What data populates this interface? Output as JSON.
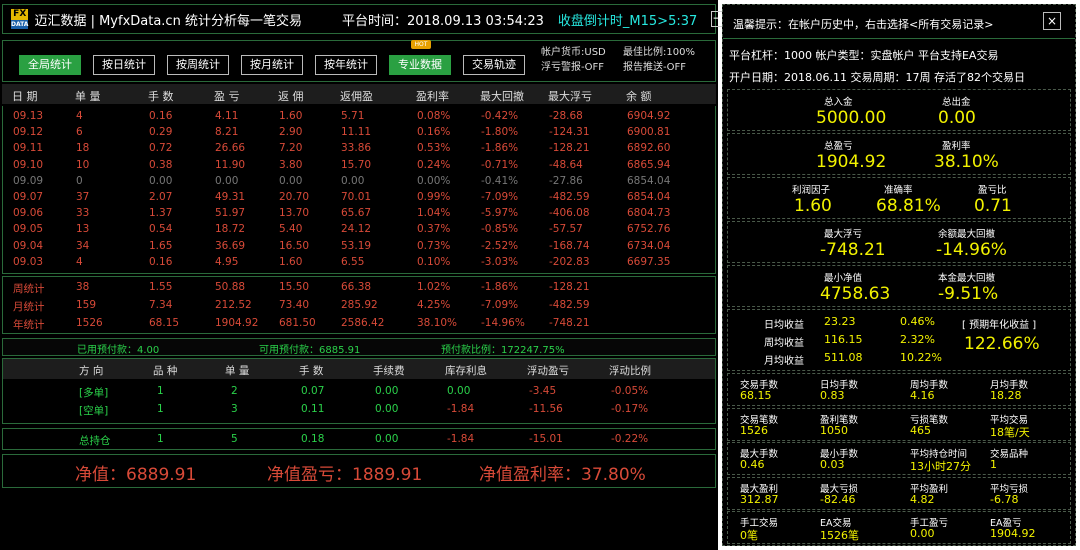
{
  "header": {
    "logo_top": "FX",
    "logo_bottom": "DATA",
    "title": "迈汇数据 | MyfxData.cn  统计分析每一笔交易",
    "platform_time": "平台时间：2018.09.13 03:54:23",
    "countdown": "收盘倒计时_M15>5:37",
    "minimize": "−"
  },
  "tabs": [
    {
      "label": "全局统计"
    },
    {
      "label": "按日统计"
    },
    {
      "label": "按周统计"
    },
    {
      "label": "按月统计"
    },
    {
      "label": "按年统计"
    },
    {
      "label": "专业数据"
    },
    {
      "label": "交易轨迹"
    }
  ],
  "hot_badge": "HOT",
  "account_info": {
    "currency": "帐户货币:USD",
    "float_alert": "浮亏警报-OFF",
    "margin_ratio": "最佳比例:100%",
    "report_push": "报告推送-OFF"
  },
  "table": {
    "headers": [
      "日 期",
      "单 量",
      "手 数",
      "盈 亏",
      "返 佣",
      "返佣盈",
      "盈利率",
      "最大回撤",
      "最大浮亏",
      "余 额"
    ],
    "rows": [
      [
        "09.13",
        "4",
        "0.16",
        "4.11",
        "1.60",
        "5.71",
        "0.08%",
        "-0.42%",
        "-28.68",
        "6904.92"
      ],
      [
        "09.12",
        "6",
        "0.29",
        "8.21",
        "2.90",
        "11.11",
        "0.16%",
        "-1.80%",
        "-124.31",
        "6900.81"
      ],
      [
        "09.11",
        "18",
        "0.72",
        "26.66",
        "7.20",
        "33.86",
        "0.53%",
        "-1.86%",
        "-128.21",
        "6892.60"
      ],
      [
        "09.10",
        "10",
        "0.38",
        "11.90",
        "3.80",
        "15.70",
        "0.24%",
        "-0.71%",
        "-48.64",
        "6865.94"
      ],
      [
        "09.09",
        "0",
        "0.00",
        "0.00",
        "0.00",
        "0.00",
        "0.00%",
        "-0.41%",
        "-27.86",
        "6854.04"
      ],
      [
        "09.07",
        "37",
        "2.07",
        "49.31",
        "20.70",
        "70.01",
        "0.99%",
        "-7.09%",
        "-482.59",
        "6854.04"
      ],
      [
        "09.06",
        "33",
        "1.37",
        "51.97",
        "13.70",
        "65.67",
        "1.04%",
        "-5.97%",
        "-406.08",
        "6804.73"
      ],
      [
        "09.05",
        "13",
        "0.54",
        "18.72",
        "5.40",
        "24.12",
        "0.37%",
        "-0.85%",
        "-57.57",
        "6752.76"
      ],
      [
        "09.04",
        "34",
        "1.65",
        "36.69",
        "16.50",
        "53.19",
        "0.73%",
        "-2.52%",
        "-168.74",
        "6734.04"
      ],
      [
        "09.03",
        "4",
        "0.16",
        "4.95",
        "1.60",
        "6.55",
        "0.10%",
        "-3.03%",
        "-202.83",
        "6697.35"
      ]
    ],
    "row_gray_index": 4,
    "summaries": [
      [
        "周统计",
        "38",
        "1.55",
        "50.88",
        "15.50",
        "66.38",
        "1.02%",
        "-1.86%",
        "-128.21"
      ],
      [
        "月统计",
        "159",
        "7.34",
        "212.52",
        "73.40",
        "285.92",
        "4.25%",
        "-7.09%",
        "-482.59"
      ],
      [
        "年统计",
        "1526",
        "68.15",
        "1904.92",
        "681.50",
        "2586.42",
        "38.10%",
        "-14.96%",
        "-748.21"
      ]
    ]
  },
  "prepay": {
    "used": "已用预付款：4.00",
    "available": "可用预付款：6885.91",
    "ratio": "预付款比例：172247.75%"
  },
  "positions": {
    "headers": [
      "方 向",
      "品 种",
      "单 量",
      "手 数",
      "手续费",
      "库存利息",
      "浮动盈亏",
      "浮动比例"
    ],
    "rows": [
      [
        "[多单]",
        "1",
        "2",
        "0.07",
        "0.00",
        "0.00",
        "-3.45",
        "-0.05%"
      ],
      [
        "[空单]",
        "1",
        "3",
        "0.11",
        "0.00",
        "-1.84",
        "-11.56",
        "-0.17%"
      ]
    ],
    "total": [
      "总持仓",
      "1",
      "5",
      "0.18",
      "0.00",
      "-1.84",
      "-15.01",
      "-0.22%"
    ]
  },
  "net": {
    "equity": "净值：6889.91",
    "pnl": "净值盈亏：1889.91",
    "rate": "净值盈利率：37.80%"
  },
  "right": {
    "tip": "温馨提示：在帐户历史中，右击选择<所有交易记录>",
    "close": "×",
    "info1": "平台杠杆：1000    帐户类型：实盘帐户    平台支持EA交易",
    "info2": "开户日期：2018.06.11   交易周期：17周   存活了82个交易日",
    "deposit_label": "总入金",
    "deposit": "5000.00",
    "withdraw_label": "总出金",
    "withdraw": "0.00",
    "profit_label": "总盈亏",
    "profit": "1904.92",
    "profit_rate_label": "盈利率",
    "profit_rate": "38.10%",
    "pf_label": "利润因子",
    "pf": "1.60",
    "accuracy_label": "准确率",
    "accuracy": "68.81%",
    "pl_ratio_label": "盈亏比",
    "pl_ratio": "0.71",
    "max_float_label": "最大浮亏",
    "max_float": "-748.21",
    "max_dd_label": "余额最大回撤",
    "max_dd": "-14.96%",
    "min_eq_label": "最小净值",
    "min_eq": "4758.63",
    "principal_dd_label": "本金最大回撤",
    "principal_dd": "-9.51%",
    "daily_label": "日均收益",
    "daily": "23.23",
    "daily_pct": "0.46%",
    "weekly_label": "周均收益",
    "weekly": "116.15",
    "weekly_pct": "2.32%",
    "monthly_label": "月均收益",
    "monthly": "511.08",
    "monthly_pct": "10.22%",
    "annual_label": "[ 预期年化收益 ]",
    "annual": "122.66%",
    "stats": [
      [
        {
          "label": "交易手数",
          "value": "68.15"
        },
        {
          "label": "日均手数",
          "value": "0.83"
        },
        {
          "label": "周均手数",
          "value": "4.16"
        },
        {
          "label": "月均手数",
          "value": "18.28"
        }
      ],
      [
        {
          "label": "交易笔数",
          "value": "1526"
        },
        {
          "label": "盈利笔数",
          "value": "1050"
        },
        {
          "label": "亏损笔数",
          "value": "465"
        },
        {
          "label": "平均交易",
          "value": "18笔/天"
        }
      ],
      [
        {
          "label": "最大手数",
          "value": "0.46"
        },
        {
          "label": "最小手数",
          "value": "0.03"
        },
        {
          "label": "平均持仓时间",
          "value": "13小时27分"
        },
        {
          "label": "交易品种",
          "value": "1"
        }
      ],
      [
        {
          "label": "最大盈利",
          "value": "312.87"
        },
        {
          "label": "最大亏损",
          "value": "-82.46"
        },
        {
          "label": "平均盈利",
          "value": "4.82"
        },
        {
          "label": "平均亏损",
          "value": "-6.78"
        }
      ],
      [
        {
          "label": "手工交易",
          "value": "0笔"
        },
        {
          "label": "EA交易",
          "value": "1526笔"
        },
        {
          "label": "手工盈亏",
          "value": "0.00"
        },
        {
          "label": "EA盈亏",
          "value": "1904.92"
        }
      ]
    ]
  },
  "colors": {
    "accent_green": "#2aa042",
    "loss_red": "#d84a38",
    "value_yellow": "#f2f200",
    "countdown_cyan": "#27e8e0"
  }
}
